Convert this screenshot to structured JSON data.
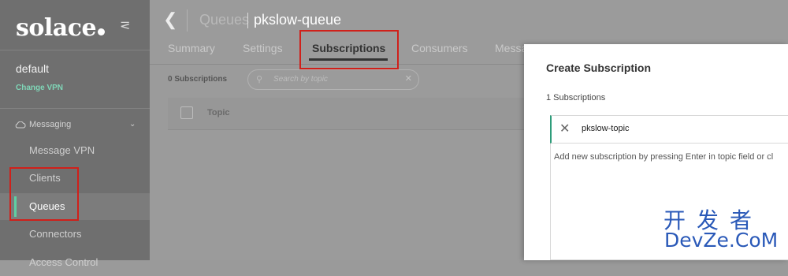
{
  "sidebar": {
    "logo": "solace",
    "vpn_name": "default",
    "change_vpn": "Change VPN",
    "section": "Messaging",
    "items": [
      {
        "label": "Message VPN"
      },
      {
        "label": "Clients"
      },
      {
        "label": "Queues"
      },
      {
        "label": "Connectors"
      },
      {
        "label": "Access Control"
      }
    ]
  },
  "header": {
    "crumb": "Queues",
    "title": "pkslow-queue"
  },
  "tabs": [
    {
      "label": "Summary"
    },
    {
      "label": "Settings"
    },
    {
      "label": "Subscriptions"
    },
    {
      "label": "Consumers"
    },
    {
      "label": "Messa"
    }
  ],
  "list": {
    "count": "0 Subscriptions",
    "search_placeholder": "Search by topic",
    "column_topic": "Topic"
  },
  "dialog": {
    "title": "Create Subscription",
    "count": "1 Subscriptions",
    "tag": "pkslow-topic",
    "hint": "Add new subscription by pressing Enter in topic field or cl"
  },
  "watermark": {
    "line1": "开发者",
    "line2": "DevZe.CoM"
  },
  "colors": {
    "accent": "#5fcfa3",
    "highlight": "#d0201a",
    "watermark": "#2a59b8"
  }
}
